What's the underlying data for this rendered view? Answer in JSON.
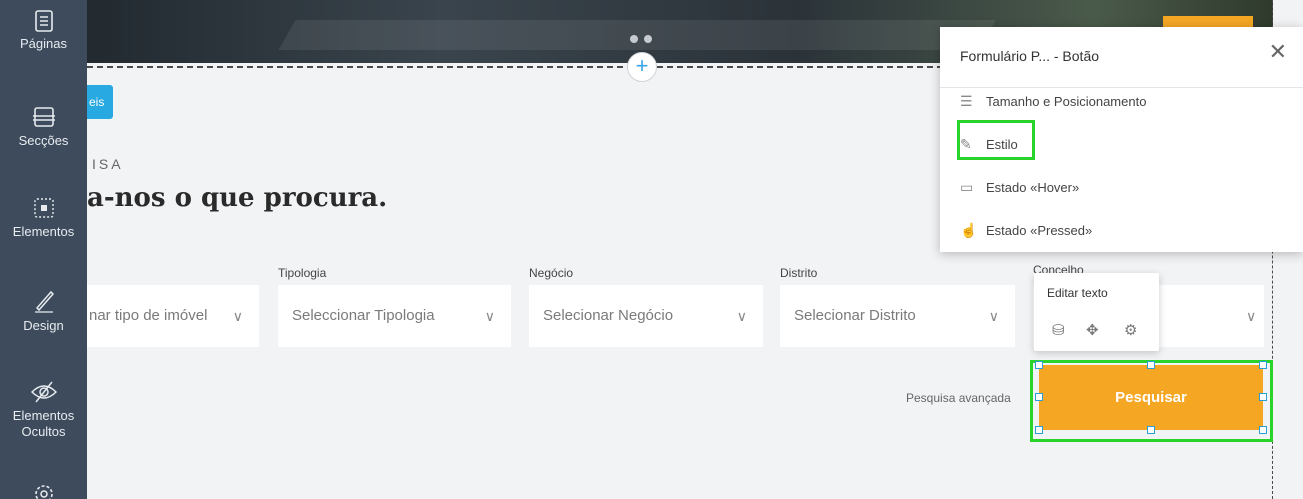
{
  "sidebar": {
    "items": [
      {
        "label": "Páginas",
        "icon": "pages-icon"
      },
      {
        "label": "Secções",
        "icon": "sections-icon"
      },
      {
        "label": "Elementos",
        "icon": "elements-icon"
      },
      {
        "label": "Design",
        "icon": "pen-icon"
      },
      {
        "label": "Elementos Ocultos",
        "label_line1": "Elementos",
        "label_line2": "Ocultos",
        "icon": "hidden-eye-icon"
      },
      {
        "label": "",
        "icon": "settings-gear-icon"
      }
    ]
  },
  "canvas": {
    "blue_chip_text": "eis",
    "eyebrow": "ISA",
    "headline": "a-nos o que procura.",
    "fields": [
      {
        "label": "",
        "placeholder": "nar tipo de imóvel"
      },
      {
        "label": "Tipologia",
        "placeholder": "Seleccionar Tipologia"
      },
      {
        "label": "Negócio",
        "placeholder": "Selecionar Negócio"
      },
      {
        "label": "Distrito",
        "placeholder": "Selecionar Distrito"
      },
      {
        "label": "Concelho",
        "placeholder": ""
      }
    ],
    "advanced_search": "Pesquisa avançada",
    "search_button": "Pesquisar",
    "add_section_symbol": "+"
  },
  "mini_toolbar": {
    "edit_text": "Editar texto",
    "icons": [
      "database-icon",
      "move-icon",
      "settings-icon"
    ]
  },
  "panel": {
    "title": "Formulário P... - Botão",
    "close_symbol": "✕",
    "items": [
      {
        "label": "Tamanho e Posicionamento",
        "icon": "sliders-icon"
      },
      {
        "label": "Estilo",
        "icon": "pencil-icon",
        "highlighted": true
      },
      {
        "label": "Estado «Hover»",
        "icon": "hover-cursor-icon"
      },
      {
        "label": "Estado «Pressed»",
        "icon": "pointer-hand-icon"
      }
    ]
  },
  "colors": {
    "sidebar": "#3d4b5c",
    "accent_orange": "#f5a623",
    "highlight_green": "#29d32a",
    "accent_blue": "#29a9e1"
  }
}
